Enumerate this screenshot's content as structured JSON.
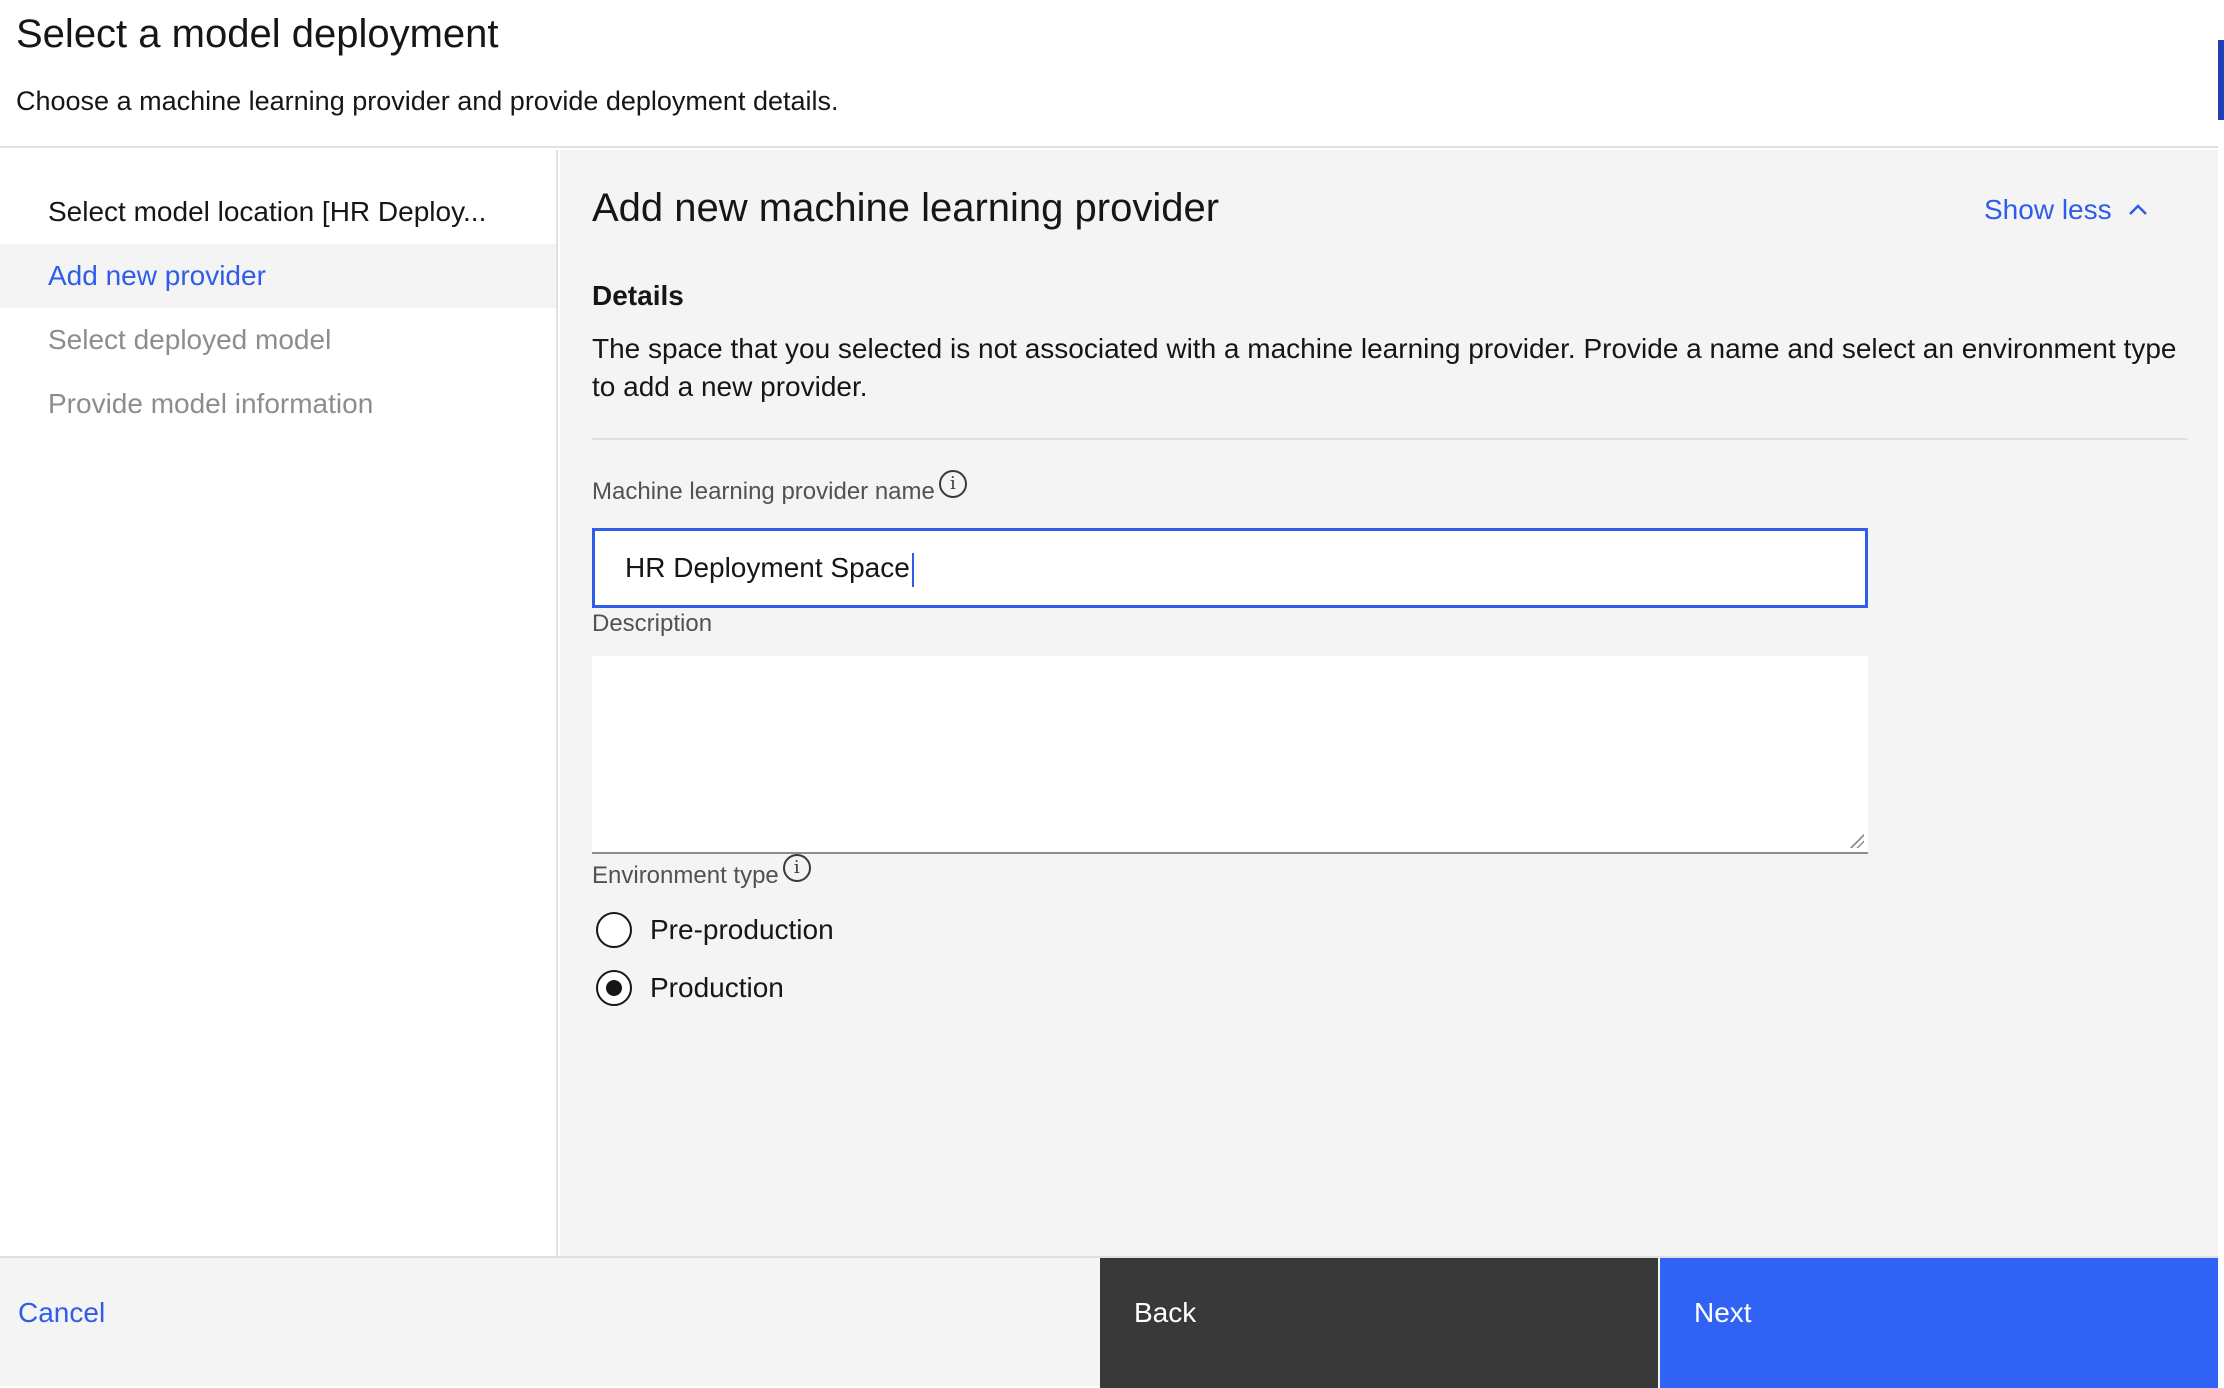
{
  "header": {
    "title": "Select a model deployment",
    "subtitle": "Choose a machine learning provider and provide deployment details."
  },
  "steps": [
    {
      "label": "Select model location [HR Deploy...",
      "state": "done"
    },
    {
      "label": "Add new provider",
      "state": "active"
    },
    {
      "label": "Select deployed model",
      "state": "pending"
    },
    {
      "label": "Provide model information",
      "state": "pending"
    }
  ],
  "main": {
    "heading": "Add new machine learning provider",
    "show_less": "Show less",
    "details_title": "Details",
    "details_text": "The space that you selected is not associated with a machine learning provider. Provide a name and select an environment type to add a new provider.",
    "name_label": "Machine learning provider name",
    "name_value": "HR Deployment Space",
    "description_label": "Description",
    "description_value": "",
    "environment_label": "Environment type",
    "radio_options": [
      {
        "label": "Pre-production",
        "checked": false
      },
      {
        "label": "Production",
        "checked": true
      }
    ]
  },
  "footer": {
    "cancel": "Cancel",
    "back": "Back",
    "next": "Next"
  },
  "colors": {
    "accent": "#2f5ce8",
    "primary_button": "#2f62f5",
    "secondary_button": "#393939"
  },
  "icons": [
    "info-icon",
    "chevron-up-icon"
  ]
}
